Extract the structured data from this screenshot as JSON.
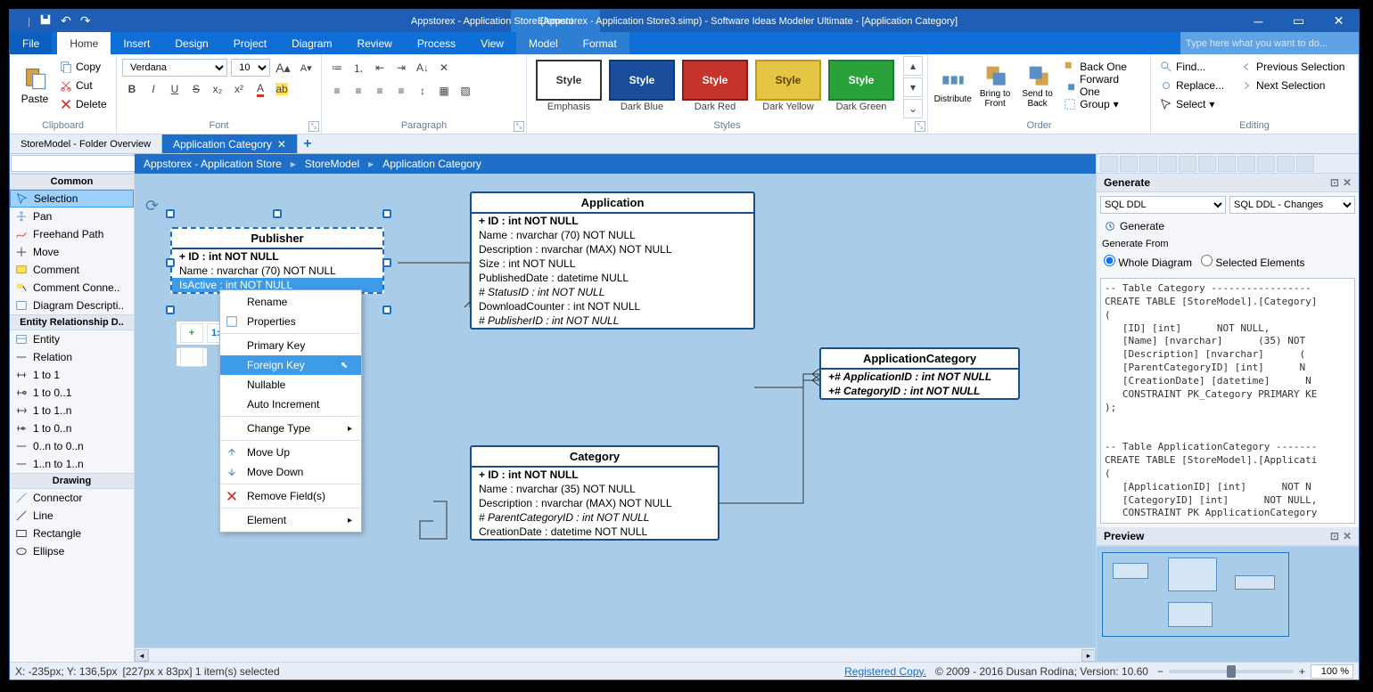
{
  "title": "Appstorex - Application Store (Appstorex - Application Store3.simp)  - Software Ideas Modeler Ultimate - [Application Category]",
  "ctxtab": "Element",
  "menus": {
    "file": "File",
    "home": "Home",
    "insert": "Insert",
    "design": "Design",
    "project": "Project",
    "diagram": "Diagram",
    "review": "Review",
    "process": "Process",
    "view": "View",
    "model": "Model",
    "format": "Format",
    "search_ph": "Type here what you want to do..."
  },
  "ribbon": {
    "clipboard": {
      "label": "Clipboard",
      "paste": "Paste",
      "copy": "Copy",
      "cut": "Cut",
      "delete": "Delete"
    },
    "font": {
      "label": "Font",
      "name": "Verdana",
      "size": "10"
    },
    "paragraph": {
      "label": "Paragraph"
    },
    "styles": {
      "label": "Styles",
      "s1": "Style",
      "l1": "Emphasis",
      "s2": "Style",
      "l2": "Dark Blue",
      "s3": "Style",
      "l3": "Dark Red",
      "s4": "Style",
      "l4": "Dark Yellow",
      "s5": "Style",
      "l5": "Dark Green"
    },
    "order": {
      "label": "Order",
      "distribute": "Distribute",
      "bfront": "Bring to Front",
      "sback": "Send to Back",
      "backone": "Back One",
      "fwdone": "Forward One",
      "group": "Group"
    },
    "editing": {
      "label": "Editing",
      "find": "Find...",
      "replace": "Replace...",
      "select": "Select",
      "prevsel": "Previous Selection",
      "nextsel": "Next Selection"
    }
  },
  "tabs": {
    "t1": "StoreModel - Folder Overview",
    "t2": "Application Category"
  },
  "breadcrumb": {
    "a": "Appstorex - Application Store",
    "b": "StoreModel",
    "c": "Application Category"
  },
  "toolbox": {
    "common": "Common",
    "selection": "Selection",
    "pan": "Pan",
    "freehand": "Freehand Path",
    "move": "Move",
    "comment": "Comment",
    "commentc": "Comment Conne..",
    "diagdesc": "Diagram Descripti..",
    "erd": "Entity Relationship D..",
    "entity": "Entity",
    "relation": "Relation",
    "r11": "1 to 1",
    "r101": "1 to 0..1",
    "r11n": "1 to 1..n",
    "r10n": "1 to 0..n",
    "r0n0n": "0..n to 0..n",
    "r1n1n": "1..n to 1..n",
    "drawing": "Drawing",
    "connector": "Connector",
    "line": "Line",
    "rectangle": "Rectangle",
    "ellipse": "Ellipse"
  },
  "entities": {
    "publisher": {
      "name": "Publisher",
      "rows": [
        "+ ID : int NOT NULL",
        "Name : nvarchar (70)  NOT NULL",
        "IsActive : int NOT NULL"
      ]
    },
    "application": {
      "name": "Application",
      "rows": [
        "+ ID : int NOT NULL",
        "Name : nvarchar (70)  NOT NULL",
        "Description : nvarchar (MAX)  NOT NULL",
        "Size : int NOT NULL",
        "PublishedDate : datetime NULL",
        "# StatusID : int NOT NULL",
        "DownloadCounter : int NOT NULL",
        "# PublisherID : int NOT NULL"
      ]
    },
    "appcat": {
      "name": "ApplicationCategory",
      "rows": [
        "+# ApplicationID : int NOT NULL",
        "+# CategoryID : int NOT NULL"
      ]
    },
    "category": {
      "name": "Category",
      "rows": [
        "+ ID : int NOT NULL",
        "Name : nvarchar (35)  NOT NULL",
        "Description : nvarchar (MAX)  NOT NULL",
        "# ParentCategoryID : int NOT NULL",
        "CreationDate : datetime NOT NULL"
      ]
    }
  },
  "floatbar": {
    "b1": "1:1"
  },
  "context": {
    "rename": "Rename",
    "props": "Properties",
    "pk": "Primary Key",
    "fk": "Foreign Key",
    "nullable": "Nullable",
    "autoinc": "Auto Increment",
    "chtype": "Change Type",
    "moveup": "Move Up",
    "movedown": "Move Down",
    "remove": "Remove Field(s)",
    "element": "Element"
  },
  "right": {
    "gen": "Generate",
    "ddl1": "SQL DDL",
    "ddl2": "SQL DDL - Changes",
    "genbtn": "Generate",
    "genfrom": "Generate From",
    "r1": "Whole Diagram",
    "r2": "Selected Elements",
    "sql": "-- Table Category -----------------\nCREATE TABLE [StoreModel].[Category]\n(\n   [ID] [int]      NOT NULL,\n   [Name] [nvarchar]      (35) NOT\n   [Description] [nvarchar]      (\n   [ParentCategoryID] [int]      N\n   [CreationDate] [datetime]      N\n   CONSTRAINT PK_Category PRIMARY KE\n);\n\n\n-- Table ApplicationCategory -------\nCREATE TABLE [StoreModel].[Applicati\n(\n   [ApplicationID] [int]      NOT N\n   [CategoryID] [int]      NOT NULL,\n   CONSTRAINT PK ApplicationCategory",
    "preview": "Preview"
  },
  "status": {
    "coords": "X: -235px; Y: 136,5px",
    "sel": "[227px x 83px] 1 item(s) selected",
    "reg": "Registered Copy.",
    "copy": "© 2009 - 2016 Dusan Rodina; Version: 10.60",
    "zoom": "100 %"
  }
}
